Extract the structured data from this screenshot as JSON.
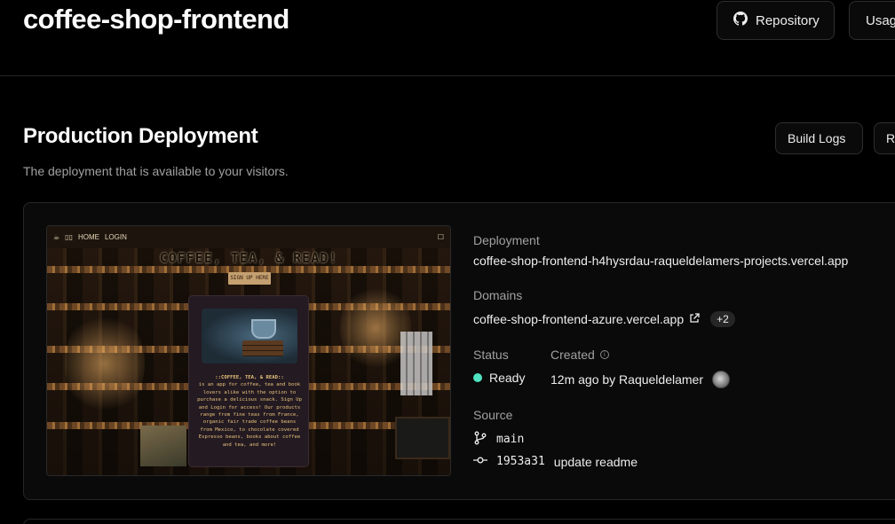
{
  "header": {
    "project_name": "coffee-shop-frontend",
    "repository_label": "Repository",
    "usage_label": "Usag"
  },
  "production": {
    "title": "Production Deployment",
    "description": "The deployment that is available to your visitors.",
    "build_logs_label": "Build Logs",
    "redeploy_label": "R"
  },
  "preview": {
    "nav_home": "HOME",
    "nav_login": "LOGIN",
    "heading": "COFFEE, TEA, & READ!",
    "signup": "SIGN UP HERE",
    "panel_title": "::COFFEE, TEA, & READ::",
    "panel_text": "is an app for coffee, tea and book lovers alike with the option to purchase a delicious snack. Sign Up and Login for access! Our products range from fine teas from France, organic fair trade coffee beans from Mexico, to chocolate covered Espresso beans, books about coffee and tea, and more!"
  },
  "details": {
    "deployment_label": "Deployment",
    "deployment_url": "coffee-shop-frontend-h4hysrdau-raqueldelamers-projects.vercel.app",
    "domains_label": "Domains",
    "domain": "coffee-shop-frontend-azure.vercel.app",
    "domains_extra": "+2",
    "status_label": "Status",
    "status_value": "Ready",
    "created_label": "Created",
    "created_value": "12m ago by Raqueldelamer",
    "source_label": "Source",
    "branch": "main",
    "commit_hash": "1953a31",
    "commit_message": "update readme"
  },
  "colors": {
    "background": "#000000",
    "status_ready": "#50e3c2",
    "muted_text": "#a1a1a1"
  }
}
